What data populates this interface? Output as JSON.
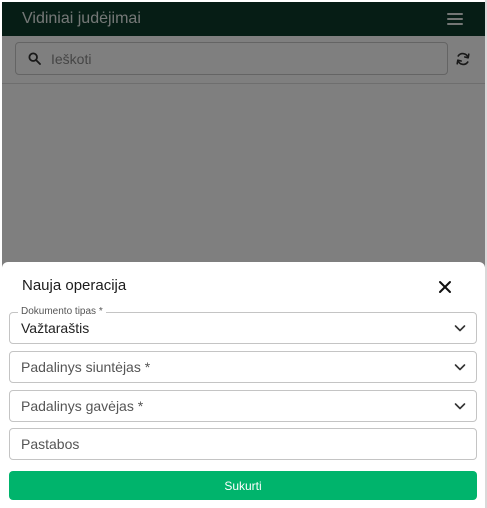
{
  "header": {
    "title": "Vidiniai judėjimai",
    "menu_icon": "hamburger-menu-icon"
  },
  "search": {
    "placeholder": "Ieškoti",
    "search_icon": "search-icon",
    "refresh_icon": "refresh-icon"
  },
  "dialog": {
    "title": "Nauja operacija",
    "close_icon": "close-icon",
    "document_type": {
      "label": "Dokumento tipas *",
      "value": "Važtaraštis"
    },
    "sender_unit": {
      "label": "Padalinys siuntėjas *"
    },
    "receiver_unit": {
      "label": "Padalinys gavėjas *"
    },
    "notes": {
      "label": "Pastabos"
    },
    "submit_label": "Sukurti"
  },
  "colors": {
    "header_bg": "#0d3b2b",
    "accent": "#00b46c",
    "overlay": "rgba(0,0,0,0.5)"
  }
}
